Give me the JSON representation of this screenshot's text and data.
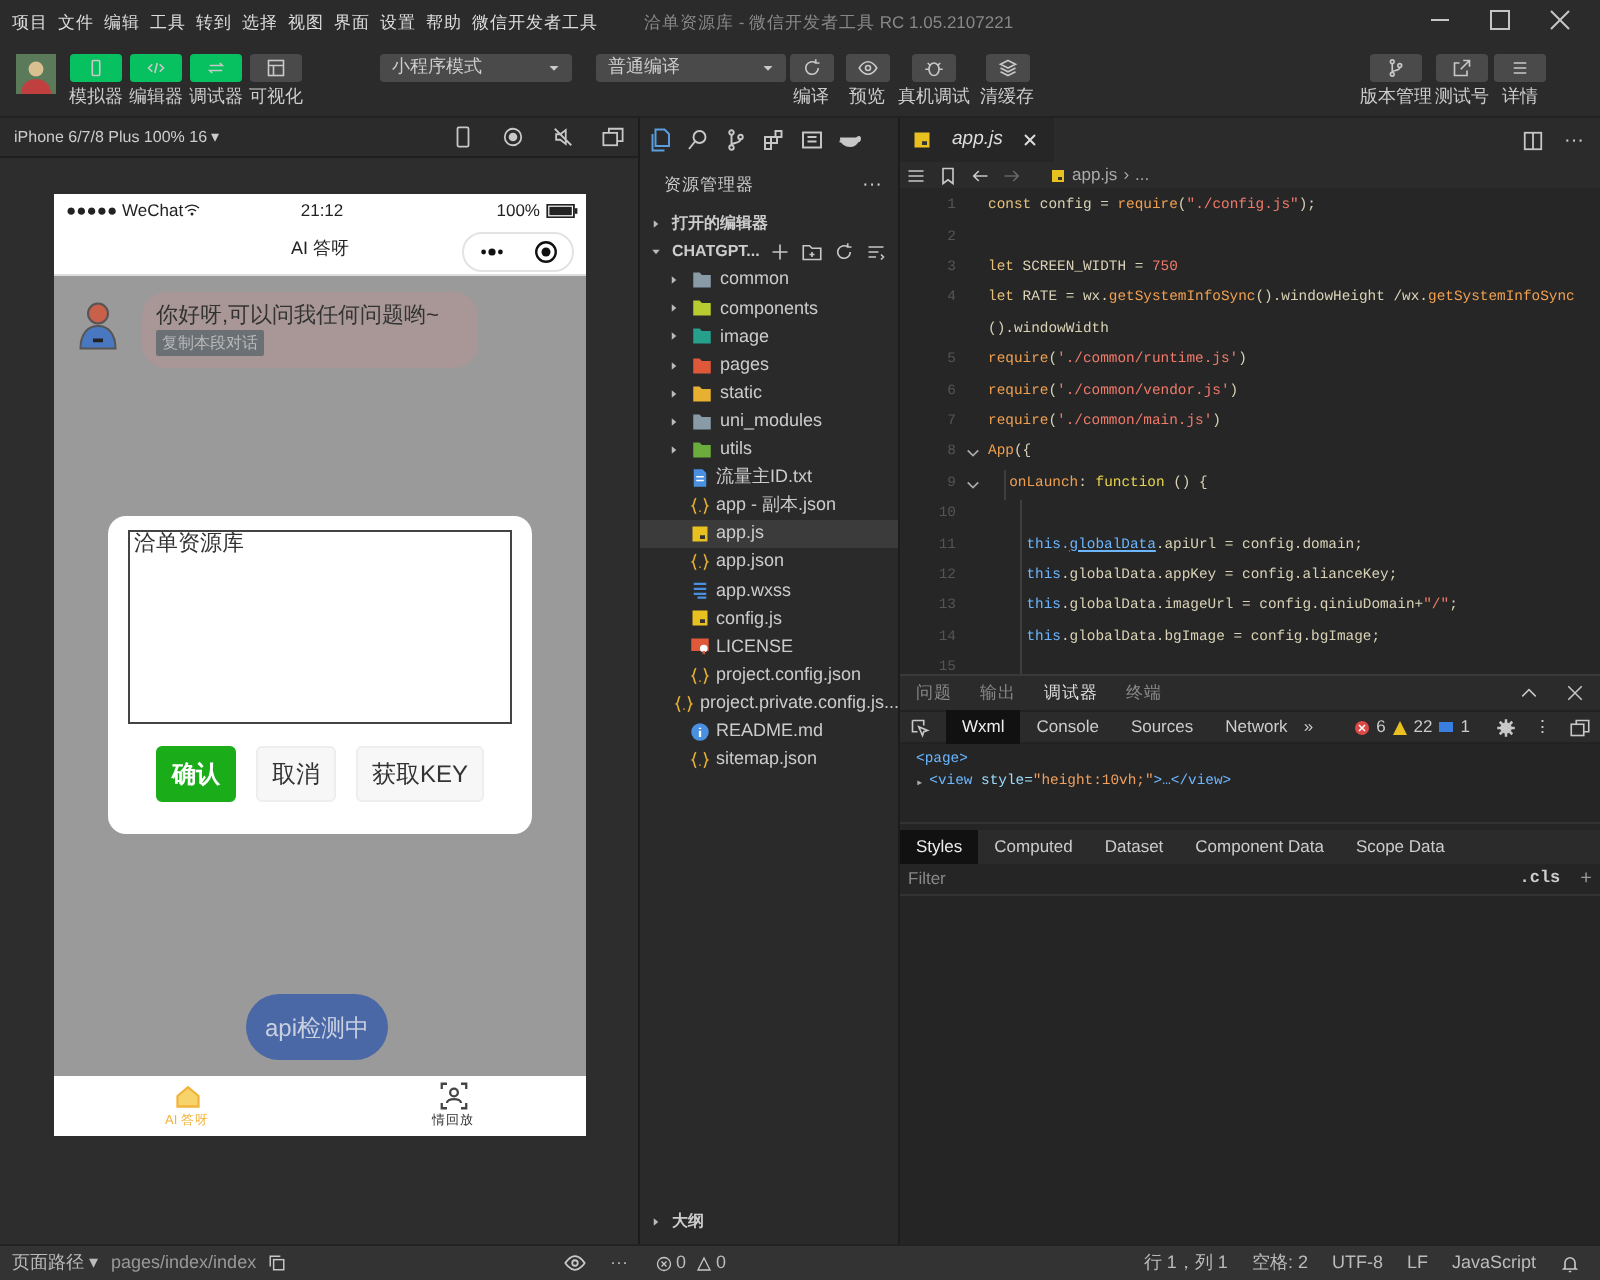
{
  "window": {
    "menu": [
      "项目",
      "文件",
      "编辑",
      "工具",
      "转到",
      "选择",
      "视图",
      "界面",
      "设置",
      "帮助",
      "微信开发者工具"
    ],
    "title": "洽单资源库 - 微信开发者工具 RC 1.05.2107221"
  },
  "toolbar": {
    "view_buttons": [
      {
        "label": "模拟器",
        "selected": true
      },
      {
        "label": "编辑器",
        "selected": true
      },
      {
        "label": "调试器",
        "selected": true
      },
      {
        "label": "可视化",
        "selected": false
      }
    ],
    "mode_select": "小程序模式",
    "compile_select": "普通编译",
    "actions": [
      {
        "label": "编译"
      },
      {
        "label": "预览"
      },
      {
        "label": "真机调试"
      },
      {
        "label": "清缓存"
      }
    ],
    "right_actions": [
      {
        "label": "版本管理"
      },
      {
        "label": "测试号"
      },
      {
        "label": "详情"
      }
    ]
  },
  "simulator": {
    "device": "iPhone 6/7/8 Plus 100% 16 ▾",
    "phone": {
      "carrier": "●●●●● WeChat",
      "time": "21:12",
      "battery": "100%",
      "nav_title": "AI 答呀",
      "message": {
        "text": "你好呀,可以问我任何问题哟~",
        "copy_button": "复制本段对话"
      },
      "dialog": {
        "value": "洽单资源库",
        "buttons": [
          {
            "label": "确认",
            "kind": "primary"
          },
          {
            "label": "取消",
            "kind": "default"
          },
          {
            "label": "获取KEY",
            "kind": "default"
          }
        ]
      },
      "float_button": "api检测中",
      "tabbar": [
        {
          "label": "AI 答呀",
          "selected": true
        },
        {
          "label": "情回放",
          "selected": false
        }
      ]
    }
  },
  "explorer": {
    "title": "资源管理器",
    "more": "···",
    "open_editors": {
      "label": "打开的编辑器",
      "expanded": false
    },
    "project": {
      "label": "CHATGPT...",
      "expanded": true
    },
    "items": [
      {
        "name": "common",
        "kind": "folder",
        "color": "#8a9ba8",
        "expanded": false,
        "selected": false
      },
      {
        "name": "components",
        "kind": "folder",
        "color": "#b8cc30",
        "expanded": false,
        "selected": false
      },
      {
        "name": "image",
        "kind": "folder",
        "color": "#26a08c",
        "expanded": false,
        "selected": false
      },
      {
        "name": "pages",
        "kind": "folder",
        "color": "#e0583a",
        "expanded": false,
        "selected": false
      },
      {
        "name": "static",
        "kind": "folder",
        "color": "#e8b030",
        "expanded": false,
        "selected": false
      },
      {
        "name": "uni_modules",
        "kind": "folder",
        "color": "#8a9ba8",
        "expanded": false,
        "selected": false
      },
      {
        "name": "utils",
        "kind": "folder",
        "color": "#6cac3c",
        "expanded": false,
        "selected": false
      },
      {
        "name": "流量主ID.txt",
        "kind": "txt",
        "selected": false
      },
      {
        "name": "app - 副本.json",
        "kind": "json",
        "selected": false
      },
      {
        "name": "app.js",
        "kind": "js",
        "selected": true
      },
      {
        "name": "app.json",
        "kind": "json",
        "selected": false
      },
      {
        "name": "app.wxss",
        "kind": "css",
        "selected": false
      },
      {
        "name": "config.js",
        "kind": "js",
        "selected": false
      },
      {
        "name": "LICENSE",
        "kind": "license",
        "selected": false
      },
      {
        "name": "project.config.json",
        "kind": "json",
        "selected": false
      },
      {
        "name": "project.private.config.js...",
        "kind": "json",
        "selected": false
      },
      {
        "name": "README.md",
        "kind": "info",
        "selected": false
      },
      {
        "name": "sitemap.json",
        "kind": "json",
        "selected": false
      }
    ],
    "outline": {
      "label": "大纲",
      "expanded": false
    }
  },
  "editor": {
    "tab": "app.js",
    "breadcrumb": [
      "app.js",
      "›",
      "..."
    ],
    "more": "···",
    "lines": [
      {
        "kind": "line",
        "number": "1",
        "tokens": [
          {
            "text": "const",
            "kind": "kw"
          },
          {
            "text": " config = ",
            "kind": "plain"
          },
          {
            "text": "require",
            "kind": "fn"
          },
          {
            "text": "(",
            "kind": "plain"
          },
          {
            "text": "\"./config.js\"",
            "kind": "str"
          },
          {
            "text": ");",
            "kind": "plain"
          }
        ]
      },
      {
        "kind": "line",
        "number": "2"
      },
      {
        "kind": "line",
        "number": "3",
        "tokens": [
          {
            "text": "let",
            "kind": "kw"
          },
          {
            "text": " SCREEN_WIDTH = ",
            "kind": "plain"
          },
          {
            "text": "750",
            "kind": "str"
          }
        ]
      },
      {
        "kind": "line",
        "number": "4",
        "tokens": [
          {
            "text": "let",
            "kind": "kw"
          },
          {
            "text": " RATE = wx.",
            "kind": "plain"
          },
          {
            "text": "getSystemInfoSync",
            "kind": "fn"
          },
          {
            "text": "().windowHeight /wx.",
            "kind": "plain"
          },
          {
            "text": "getSystemInfoSync",
            "kind": "fn"
          }
        ]
      },
      {
        "kind": "wrap",
        "tokens": [
          {
            "text": "().windowWidth",
            "kind": "plain"
          }
        ]
      },
      {
        "kind": "line",
        "number": "5",
        "tokens": [
          {
            "text": "require",
            "kind": "fn"
          },
          {
            "text": "(",
            "kind": "plain"
          },
          {
            "text": "'./common/runtime.js'",
            "kind": "str"
          },
          {
            "text": ")",
            "kind": "plain"
          }
        ]
      },
      {
        "kind": "line",
        "number": "6",
        "tokens": [
          {
            "text": "require",
            "kind": "fn"
          },
          {
            "text": "(",
            "kind": "plain"
          },
          {
            "text": "'./common/vendor.js'",
            "kind": "str"
          },
          {
            "text": ")",
            "kind": "plain"
          }
        ]
      },
      {
        "kind": "line",
        "number": "7",
        "tokens": [
          {
            "text": "require",
            "kind": "fn"
          },
          {
            "text": "(",
            "kind": "plain"
          },
          {
            "text": "'./common/main.js'",
            "kind": "str"
          },
          {
            "text": ")",
            "kind": "plain"
          }
        ]
      },
      {
        "kind": "fold",
        "number": "8",
        "tokens": [
          {
            "text": "App",
            "kind": "fn"
          },
          {
            "text": "({",
            "kind": "plain"
          }
        ],
        "children": [
          {
            "kind": "fold",
            "number": "9",
            "tokens": [
              {
                "text": "onLaunch",
                "kind": "fn"
              },
              {
                "text": ": ",
                "kind": "plain"
              },
              {
                "text": "function",
                "kind": "kw2"
              },
              {
                "text": " () {",
                "kind": "plain"
              }
            ],
            "children": [
              {
                "kind": "line",
                "number": "10"
              },
              {
                "kind": "line",
                "number": "11",
                "tokens": [
                  {
                    "text": "this.",
                    "kind": "this"
                  },
                  {
                    "text": "globalData",
                    "kind": "link"
                  },
                  {
                    "text": ".apiUrl = config.domain;",
                    "kind": "plain"
                  }
                ]
              },
              {
                "kind": "line",
                "number": "12",
                "tokens": [
                  {
                    "text": "this",
                    "kind": "this"
                  },
                  {
                    "text": ".globalData.appKey = config.alianceKey;",
                    "kind": "plain"
                  }
                ]
              },
              {
                "kind": "line",
                "number": "13",
                "tokens": [
                  {
                    "text": "this",
                    "kind": "this"
                  },
                  {
                    "text": ".globalData.imageUrl = config.qiniuDomain+",
                    "kind": "plain"
                  },
                  {
                    "text": "\"/\"",
                    "kind": "str"
                  },
                  {
                    "text": ";",
                    "kind": "plain"
                  }
                ]
              },
              {
                "kind": "line",
                "number": "14",
                "tokens": [
                  {
                    "text": "this",
                    "kind": "this"
                  },
                  {
                    "text": ".globalData.bgImage = config.bgImage;",
                    "kind": "plain"
                  }
                ]
              },
              {
                "kind": "line",
                "number": "15"
              }
            ]
          }
        ]
      }
    ]
  },
  "devtools": {
    "tabs": [
      {
        "label": "问题",
        "selected": false
      },
      {
        "label": "输出",
        "selected": false
      },
      {
        "label": "调试器",
        "selected": true
      },
      {
        "label": "终端",
        "selected": false
      }
    ],
    "panels": [
      {
        "label": "Wxml",
        "selected": true
      },
      {
        "label": "Console",
        "selected": false
      },
      {
        "label": "Sources",
        "selected": false
      },
      {
        "label": "Network",
        "selected": false
      }
    ],
    "overflow": "»",
    "errors": "6",
    "warnings": "22",
    "infos": "1",
    "more": "⋮",
    "wxml": [
      {
        "tokens": [
          {
            "text": "<page>",
            "kind": "tag"
          }
        ]
      },
      {
        "caret": "▸",
        "tokens": [
          {
            "text": "<view ",
            "kind": "tag"
          },
          {
            "text": "style=",
            "kind": "attr"
          },
          {
            "text": "\"height:10vh;\"",
            "kind": "val"
          },
          {
            "text": ">…</view>",
            "kind": "tag"
          }
        ]
      }
    ],
    "style_tabs": [
      {
        "label": "Styles",
        "selected": true
      },
      {
        "label": "Computed",
        "selected": false
      },
      {
        "label": "Dataset",
        "selected": false
      },
      {
        "label": "Component Data",
        "selected": false
      },
      {
        "label": "Scope Data",
        "selected": false
      }
    ],
    "filter": {
      "placeholder": "Filter"
    },
    "cls": ".cls",
    "add": "+"
  },
  "status_bar": {
    "page_path": "页面路径 ▾",
    "path": "pages/index/index",
    "more": "···",
    "errors": "0",
    "warnings": "0",
    "position": "行 1，列 1",
    "spaces": "空格: 2",
    "encoding": "UTF-8",
    "eol": "LF",
    "language": "JavaScript"
  }
}
